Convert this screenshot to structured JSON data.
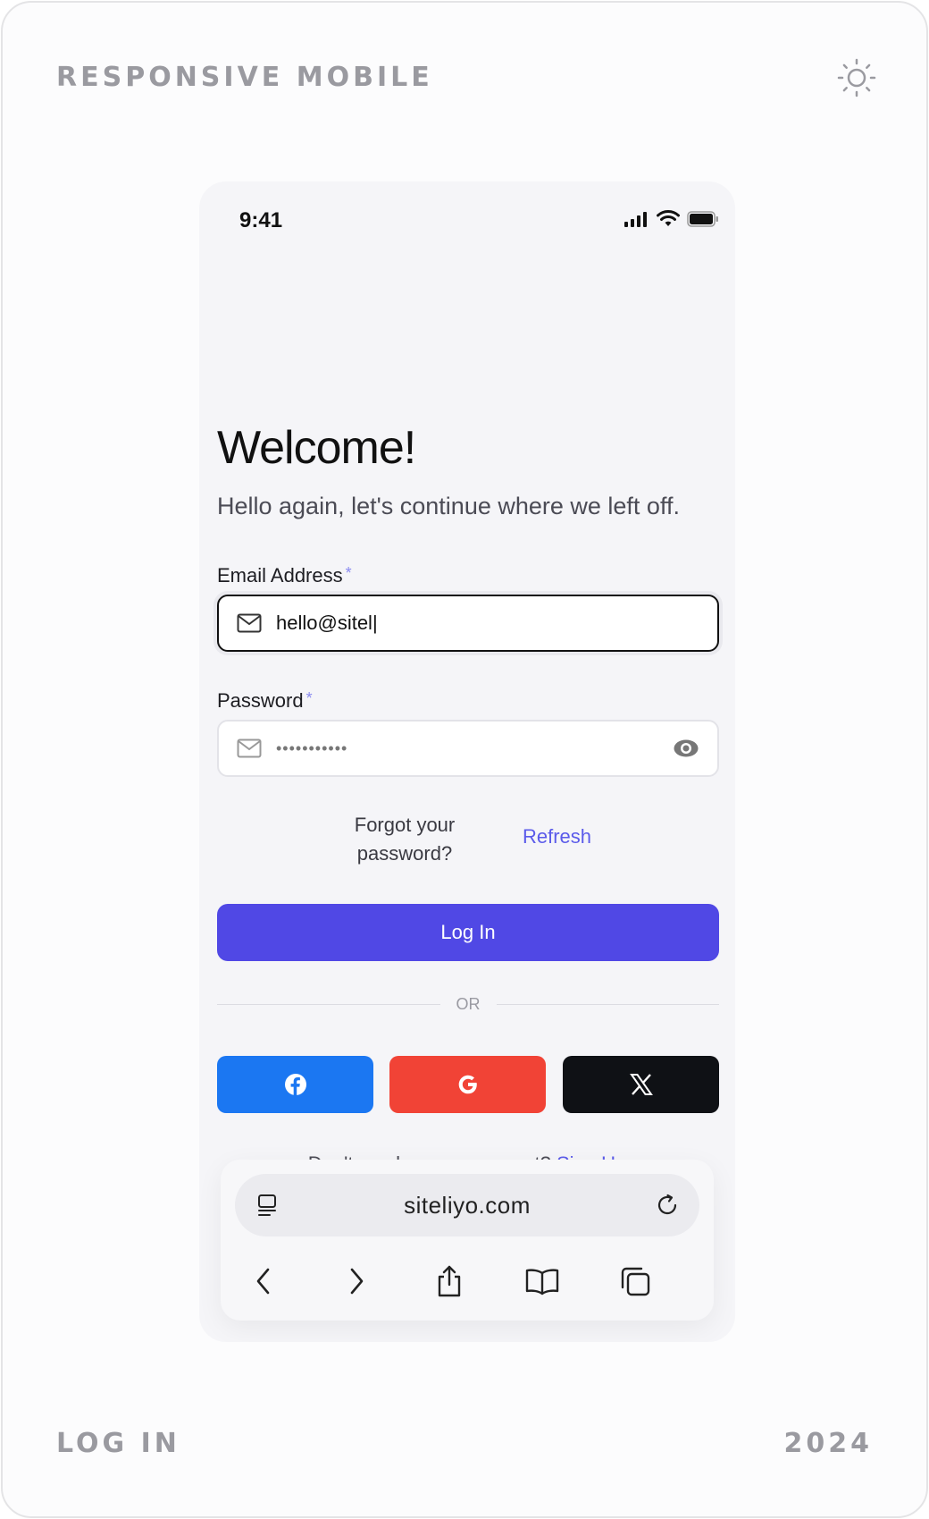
{
  "frame": {
    "top_left_label": "RESPONSIVE MOBILE",
    "bottom_left_label": "LOG IN",
    "bottom_right_label": "2024",
    "theme_icon": "sun-icon"
  },
  "status_bar": {
    "time": "9:41",
    "icons": [
      "cellular-signal-icon",
      "wifi-icon",
      "battery-icon"
    ]
  },
  "login": {
    "title": "Welcome!",
    "subtitle": "Hello again, let's continue where we left off.",
    "email": {
      "label": "Email Address",
      "required_mark": "*",
      "value": "hello@sitel|",
      "icon": "mail-icon"
    },
    "password": {
      "label": "Password",
      "required_mark": "*",
      "value": "•••••••••••",
      "icon": "mail-icon",
      "toggle_icon": "eye-icon"
    },
    "forgot_line1": "Forgot your",
    "forgot_line2": "password?",
    "refresh_label": "Refresh",
    "login_button": "Log In",
    "divider_text": "OR",
    "social": [
      {
        "name": "facebook",
        "icon": "facebook-icon",
        "color": "#1b77f2"
      },
      {
        "name": "google",
        "icon": "google-icon",
        "color": "#f14336"
      },
      {
        "name": "x",
        "icon": "x-logo-icon",
        "color": "#0f1115"
      }
    ],
    "signup_prompt": "Don't you have an account?",
    "signup_link": "Sign Up"
  },
  "browser": {
    "url": "siteliyo.com",
    "page_icon": "page-settings-icon",
    "reload_icon": "reload-icon",
    "nav_icons": [
      "back-icon",
      "forward-icon",
      "share-icon",
      "bookmarks-icon",
      "tabs-icon"
    ]
  },
  "colors": {
    "primary": "#5048e5",
    "link": "#5b5bea",
    "facebook": "#1b77f2",
    "google": "#f14336",
    "x": "#0f1115"
  }
}
